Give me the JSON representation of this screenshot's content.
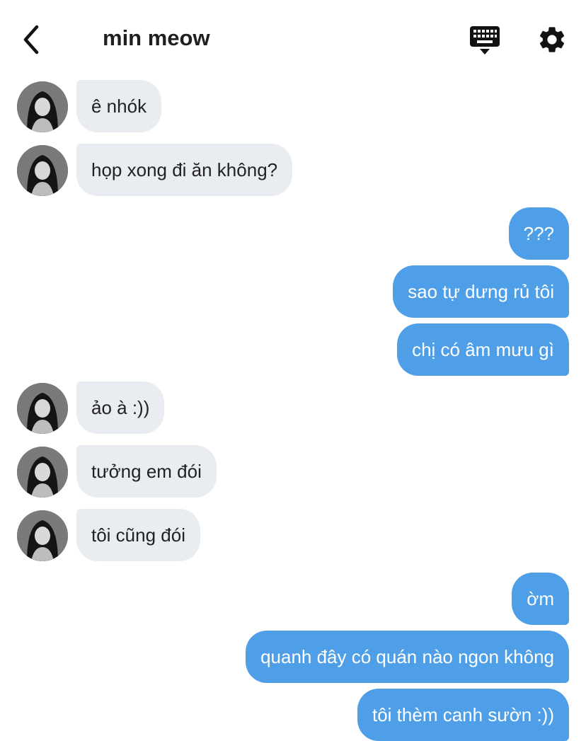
{
  "header": {
    "title": "min meow",
    "icons": {
      "back": "chevron-left-icon",
      "keyboard": "keyboard-icon",
      "settings": "gear-icon"
    }
  },
  "colors": {
    "incoming_bubble": "#e9ecf1",
    "outgoing_bubble": "#4e9fe8",
    "incoming_text": "#222222",
    "outgoing_text": "#ffffff"
  },
  "messages": [
    {
      "sender": "contact",
      "text": "ê nhók"
    },
    {
      "sender": "contact",
      "text": "họp xong đi ăn không?"
    },
    {
      "sender": "me",
      "text": "???"
    },
    {
      "sender": "me",
      "text": "sao tự dưng rủ tôi"
    },
    {
      "sender": "me",
      "text": "chị có âm mưu gì"
    },
    {
      "sender": "contact",
      "text": "ảo à :))"
    },
    {
      "sender": "contact",
      "text": "tưởng em đói"
    },
    {
      "sender": "contact",
      "text": "tôi cũng đói"
    },
    {
      "sender": "me",
      "text": "ờm"
    },
    {
      "sender": "me",
      "text": "quanh đây có quán nào ngon không"
    },
    {
      "sender": "me",
      "text": "tôi thèm canh sườn :))"
    }
  ]
}
